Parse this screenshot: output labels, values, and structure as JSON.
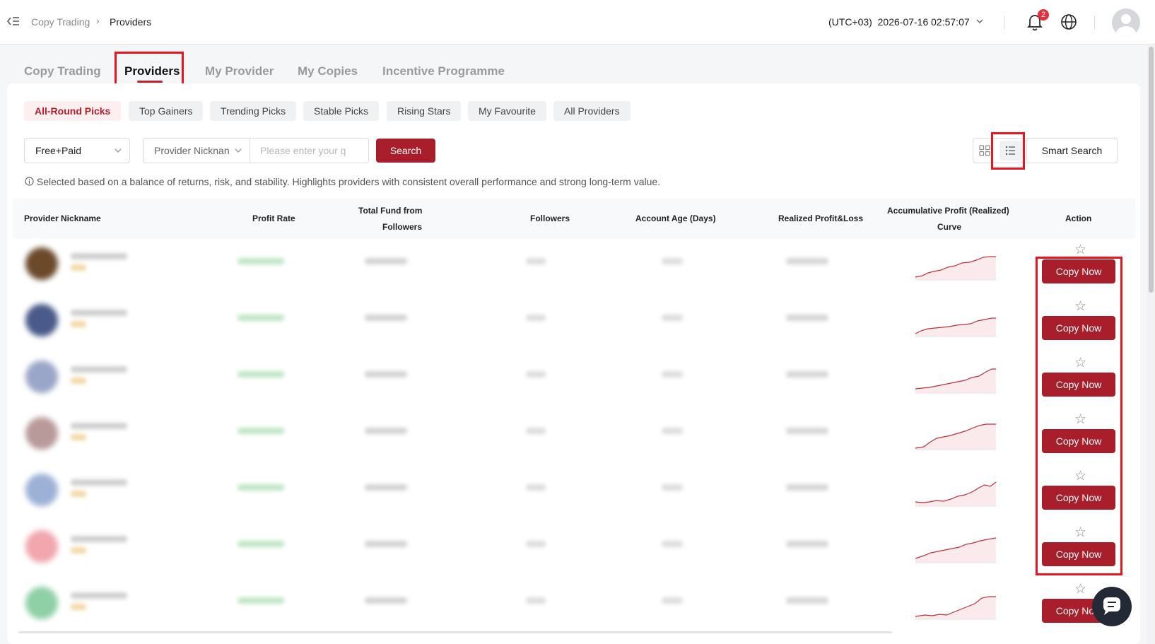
{
  "header": {
    "breadcrumb": [
      "Copy Trading",
      "Providers"
    ],
    "timezone": "(UTC+03)",
    "datetime": "2026-07-16 02:57:07",
    "notification_count": "2"
  },
  "main_tabs": [
    {
      "label": "Copy Trading",
      "active": false
    },
    {
      "label": "Providers",
      "active": true
    },
    {
      "label": "My Provider",
      "active": false
    },
    {
      "label": "My Copies",
      "active": false
    },
    {
      "label": "Incentive Programme",
      "active": false
    }
  ],
  "filters": [
    {
      "label": "All-Round Picks",
      "active": true
    },
    {
      "label": "Top Gainers",
      "active": false
    },
    {
      "label": "Trending Picks",
      "active": false
    },
    {
      "label": "Stable Picks",
      "active": false
    },
    {
      "label": "Rising Stars",
      "active": false
    },
    {
      "label": "My Favourite",
      "active": false
    },
    {
      "label": "All Providers",
      "active": false
    }
  ],
  "search": {
    "type_select": "Free+Paid",
    "field_select": "Provider Nicknan",
    "placeholder": "Please enter your q",
    "button": "Search",
    "smart_search": "Smart Search"
  },
  "note": "Selected based on a balance of returns, risk, and stability. Highlights providers with consistent overall performance and strong long-term value.",
  "table": {
    "columns": [
      "Provider Nickname",
      "Profit Rate",
      "Total Fund from",
      "Followers",
      "Followers",
      "Account Age (Days)",
      "Realized Profit&Loss",
      "Accumulative Profit (Realized)",
      "Curve",
      "Action"
    ],
    "action_label": "Copy Now",
    "rows": [
      {
        "avatar_color": "#6b4a2b"
      },
      {
        "avatar_color": "#4a5a8a"
      },
      {
        "avatar_color": "#9aa6c8"
      },
      {
        "avatar_color": "#b89a9a"
      },
      {
        "avatar_color": "#9db0d6"
      },
      {
        "avatar_color": "#f2a6ae"
      },
      {
        "avatar_color": "#8fd0a6"
      }
    ]
  },
  "colors": {
    "accent": "#a91e2b",
    "highlight_box": "#e8141f",
    "sparkline": "#c0303c"
  },
  "icons": [
    "collapse-menu-icon",
    "chevron-right-icon",
    "chevron-down-icon",
    "bell-icon",
    "globe-icon",
    "user-avatar-icon",
    "grid-view-icon",
    "list-view-icon",
    "info-icon",
    "star-icon",
    "chat-icon"
  ]
}
